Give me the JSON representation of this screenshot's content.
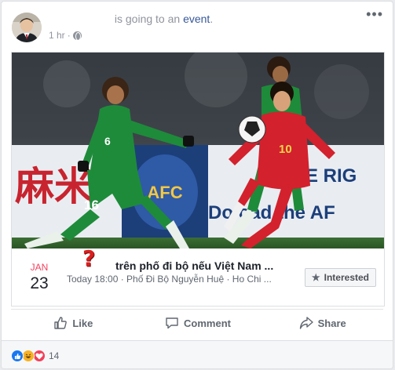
{
  "post": {
    "author_name": "",
    "verb_text": "is going to an",
    "object_link": "event",
    "period": ".",
    "timestamp": "1 hr",
    "separator": "·",
    "privacy_icon": "globe-icon",
    "more_icon": "more-options-icon"
  },
  "event": {
    "month": "JAN",
    "day": "23",
    "title": "trên phố đi bộ nếu Việt Nam ...",
    "subtitle": "Today 18:00 · Phố Đi Bộ Nguyễn Huệ · Ho Chi ...",
    "overlay_mark": "?",
    "interested_label": "Interested",
    "photo_board_text_left": "麻米",
    "photo_board_text_right_top": "THE RIG",
    "photo_board_text_right_bottom": "Do   oad the AF",
    "photo_board_logo": "AFC",
    "player_left_number": "16",
    "player_left_back_number": "6",
    "player_right_number": "10"
  },
  "actions": {
    "like_label": "Like",
    "comment_label": "Comment",
    "share_label": "Share"
  },
  "reactions": {
    "types": [
      "like",
      "haha",
      "love"
    ],
    "count": "14"
  },
  "colors": {
    "link": "#365899",
    "month_red": "#f3425f",
    "iraq_green": "#1e8b3a",
    "vietnam_red": "#d3212d"
  }
}
